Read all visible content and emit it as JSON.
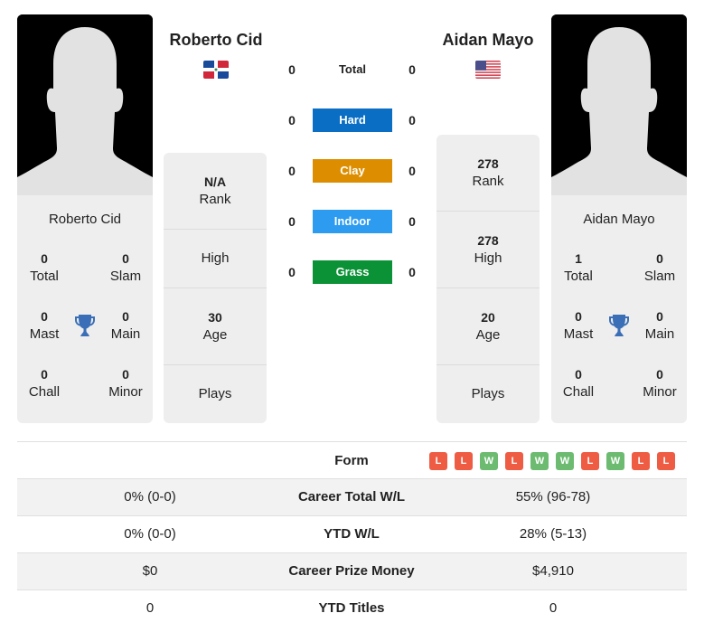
{
  "colors": {
    "hard": "#0a6ec4",
    "clay": "#dd8e00",
    "indoor": "#2d9cf0",
    "grass": "#0c9236",
    "win": "#6dbb71",
    "loss": "#ef5c44",
    "trophy": "#3a6fb7",
    "card_bg": "#eeeeee"
  },
  "players": {
    "left": {
      "name": "Roberto Cid",
      "flag_icon": "dominican-republic-flag",
      "titles": {
        "total": {
          "value": "0",
          "label": "Total"
        },
        "slam": {
          "value": "0",
          "label": "Slam"
        },
        "mast": {
          "value": "0",
          "label": "Mast"
        },
        "main": {
          "value": "0",
          "label": "Main"
        },
        "chall": {
          "value": "0",
          "label": "Chall"
        },
        "minor": {
          "value": "0",
          "label": "Minor"
        }
      },
      "info": {
        "rank": {
          "value": "N/A",
          "label": "Rank"
        },
        "high": {
          "value": "",
          "label": "High"
        },
        "age": {
          "value": "30",
          "label": "Age"
        },
        "plays": {
          "value": "",
          "label": "Plays"
        }
      }
    },
    "right": {
      "name": "Aidan Mayo",
      "flag_icon": "usa-flag",
      "titles": {
        "total": {
          "value": "1",
          "label": "Total"
        },
        "slam": {
          "value": "0",
          "label": "Slam"
        },
        "mast": {
          "value": "0",
          "label": "Mast"
        },
        "main": {
          "value": "0",
          "label": "Main"
        },
        "chall": {
          "value": "0",
          "label": "Chall"
        },
        "minor": {
          "value": "0",
          "label": "Minor"
        }
      },
      "info": {
        "rank": {
          "value": "278",
          "label": "Rank"
        },
        "high": {
          "value": "278",
          "label": "High"
        },
        "age": {
          "value": "20",
          "label": "Age"
        },
        "plays": {
          "value": "",
          "label": "Plays"
        }
      }
    }
  },
  "h2h": [
    {
      "label": "Total",
      "left": "0",
      "right": "0"
    },
    {
      "label": "Hard",
      "left": "0",
      "right": "0"
    },
    {
      "label": "Clay",
      "left": "0",
      "right": "0"
    },
    {
      "label": "Indoor",
      "left": "0",
      "right": "0"
    },
    {
      "label": "Grass",
      "left": "0",
      "right": "0"
    }
  ],
  "form": {
    "label": "Form",
    "results": [
      "L",
      "L",
      "W",
      "L",
      "W",
      "W",
      "L",
      "W",
      "L",
      "L"
    ]
  },
  "stats": [
    {
      "label": "Career Total W/L",
      "left": "0% (0-0)",
      "right": "55% (96-78)"
    },
    {
      "label": "YTD W/L",
      "left": "0% (0-0)",
      "right": "28% (5-13)"
    },
    {
      "label": "Career Prize Money",
      "left": "$0",
      "right": "$4,910"
    },
    {
      "label": "YTD Titles",
      "left": "0",
      "right": "0"
    }
  ]
}
